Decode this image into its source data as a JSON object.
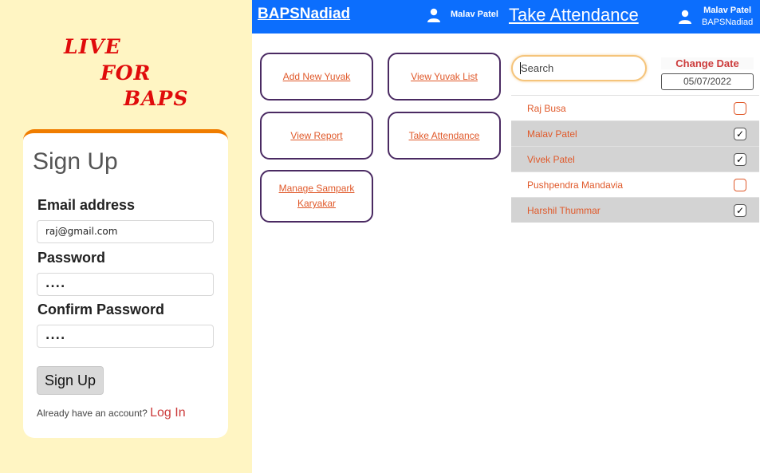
{
  "signup": {
    "brand_lines": [
      "LIVE",
      "FOR",
      "BAPS"
    ],
    "title": "Sign Up",
    "email_label": "Email address",
    "email_value": "raj@gmail.com",
    "password_label": "Password",
    "password_value": "....",
    "confirm_label": "Confirm Password",
    "confirm_value": "....",
    "button_label": "Sign Up",
    "login_prompt": "Already have an account?",
    "login_link": "Log In"
  },
  "dashboard": {
    "brand": "BAPSNadiad",
    "user_name": "Malav Patel",
    "buttons": [
      "Add New Yuvak",
      "View Yuvak List",
      "View Report",
      "Take Attendance",
      "Manage Sampark Karyakar"
    ]
  },
  "attendance": {
    "title": "Take Attendance",
    "user_name": "Malav Patel",
    "user_org": "BAPSNadiad",
    "search_placeholder": "Search",
    "change_date_label": "Change Date",
    "date_value": "05/07/2022",
    "rows": [
      {
        "name": "Raj Busa",
        "present": false
      },
      {
        "name": "Malav Patel",
        "present": true
      },
      {
        "name": "Vivek Patel",
        "present": true
      },
      {
        "name": "Pushpendra Mandavia",
        "present": false
      },
      {
        "name": "Harshil Thummar",
        "present": true
      }
    ]
  },
  "colors": {
    "topbar": "#0c6efd",
    "signup_bg": "#fff5c3",
    "brand_red": "#e00b0b",
    "accent_orange": "#f07d00",
    "link_orange": "#e0592a",
    "button_border": "#4a2a62"
  },
  "icons": {
    "user": "user-icon",
    "check": "checkmark-icon"
  }
}
